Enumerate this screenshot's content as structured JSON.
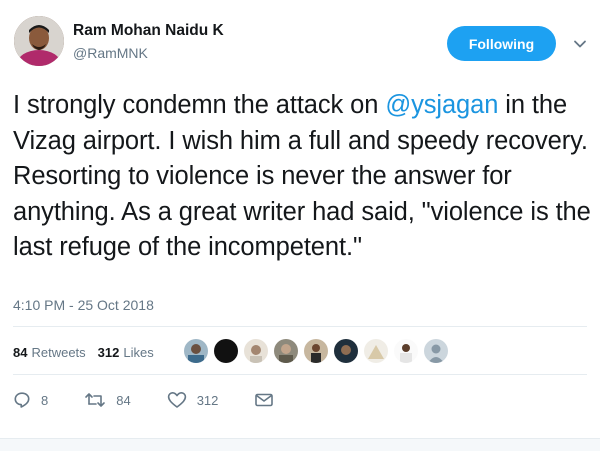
{
  "author": {
    "name": "Ram Mohan Naidu K",
    "handle": "@RamMNK",
    "follow_label": "Following"
  },
  "tweet": {
    "text_part1": "I strongly condemn the attack on ",
    "mention": "@ysjagan",
    "text_part2": " in the Vizag airport. I wish him a full and speedy recovery.  Resorting to violence is never the answer for anything. As a great writer had said, \"violence is the last refuge of the incompetent.\"",
    "timestamp": "4:10 PM - 25 Oct 2018"
  },
  "stats": {
    "retweets_count": "84",
    "retweets_label": "Retweets",
    "likes_count": "312",
    "likes_label": "Likes"
  },
  "actions": {
    "replies": "8",
    "retweets": "84",
    "likes": "312"
  },
  "colors": {
    "accent": "#1da1f2",
    "mention": "#1b95e0",
    "secondary_text": "#657786"
  }
}
